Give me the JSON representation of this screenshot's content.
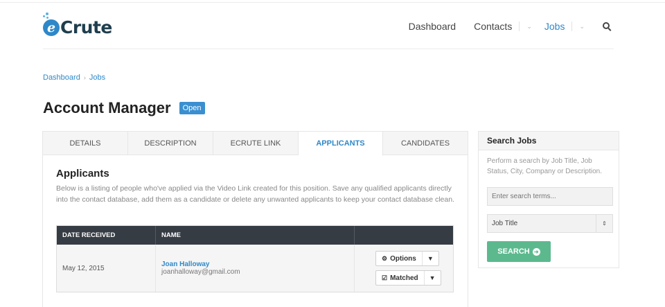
{
  "brand": {
    "logo_text": "Crute",
    "logo_mark": "e"
  },
  "nav": {
    "items": [
      {
        "label": "Dashboard"
      },
      {
        "label": "Contacts"
      },
      {
        "label": "Jobs"
      }
    ],
    "chevron": "⌄",
    "active_color": "#2e88c8"
  },
  "breadcrumb": {
    "items": [
      "Dashboard",
      "Jobs"
    ],
    "separator": "›"
  },
  "page": {
    "title": "Account Manager",
    "status_badge": "Open"
  },
  "tabs": [
    {
      "label": "DETAILS"
    },
    {
      "label": "DESCRIPTION"
    },
    {
      "label": "ECRUTE LINK"
    },
    {
      "label": "APPLICANTS",
      "active": true
    },
    {
      "label": "CANDIDATES"
    }
  ],
  "applicants": {
    "heading": "Applicants",
    "description": "Below is a listing of people who've applied via the Video Link created for this position. Save any qualified applicants directly into the contact database, add them as a candidate or delete any unwanted applicants to keep your contact database clean.",
    "columns": [
      "DATE RECEIVED",
      "NAME",
      ""
    ],
    "rows": [
      {
        "date": "May 12, 2015",
        "name": "Joan Halloway",
        "email": "joanhalloway@gmail.com",
        "options_label": "Options",
        "matched_label": "Matched"
      }
    ]
  },
  "sidebar": {
    "title": "Search Jobs",
    "description": "Perform a search by Job Title, Job Status, City, Company or Description.",
    "search_placeholder": "Enter search terms...",
    "filter_selected": "Job Title",
    "search_button": "SEARCH",
    "button_color": "#5cb98e"
  }
}
